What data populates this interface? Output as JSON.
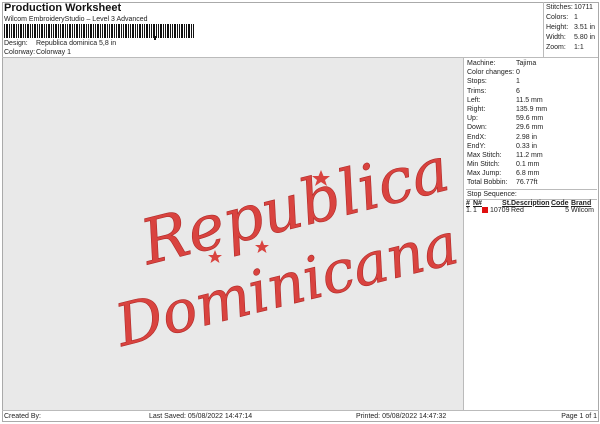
{
  "header": {
    "title": "Production Worksheet",
    "subtitle": "Wilcom EmbroideryStudio – Level 3 Advanced",
    "barcode_suffix": ",",
    "design_label": "Design:",
    "design": "Republica dominica 5,8 in",
    "colorway_label": "Colorway:",
    "colorway": "Colorway 1"
  },
  "stats": [
    {
      "k": "Stitches:",
      "v": "10711"
    },
    {
      "k": "Colors:",
      "v": "1"
    },
    {
      "k": "Height:",
      "v": "3.51 in"
    },
    {
      "k": "Width:",
      "v": "5.80 in"
    },
    {
      "k": "Zoom:",
      "v": "1:1"
    }
  ],
  "design_art": {
    "line1": "Republica",
    "line2": "Dominicana",
    "color": "#d9433f",
    "background": "#e9e9e9"
  },
  "panel": [
    {
      "k": "Machine:",
      "v": "Tajima"
    },
    {
      "k": "Color changes:",
      "v": "0"
    },
    {
      "k": "Stops:",
      "v": "1"
    },
    {
      "k": "Trims:",
      "v": "6"
    },
    {
      "k": "Left:",
      "v": "11.5 mm"
    },
    {
      "k": "Right:",
      "v": "135.9 mm"
    },
    {
      "k": "Up:",
      "v": "59.6 mm"
    },
    {
      "k": "Down:",
      "v": "29.6 mm"
    },
    {
      "k": "EndX:",
      "v": "2.98 in"
    },
    {
      "k": "EndY:",
      "v": "0.33 in"
    },
    {
      "k": "Max Stitch:",
      "v": "11.2 mm"
    },
    {
      "k": "Min Stitch:",
      "v": "0.1 mm"
    },
    {
      "k": "Max Jump:",
      "v": "6.8 mm"
    },
    {
      "k": "Total Bobbin:",
      "v": "76.77ft"
    }
  ],
  "stop_sequence": {
    "label": "Stop Sequence:",
    "columns": [
      "#",
      "N#",
      "St.",
      "Description",
      "Code",
      "Brand"
    ],
    "rows": [
      {
        "num": "1.",
        "n": "1",
        "color": "#e01010",
        "st": "10709",
        "desc": "Red",
        "code": "5",
        "brand": "Wilcom"
      }
    ]
  },
  "footer": {
    "created": "Created By:",
    "saved": "Last Saved: 05/08/2022 14:47:14",
    "printed": "Printed: 05/08/2022 14:47:32",
    "page": "Page 1 of 1"
  }
}
